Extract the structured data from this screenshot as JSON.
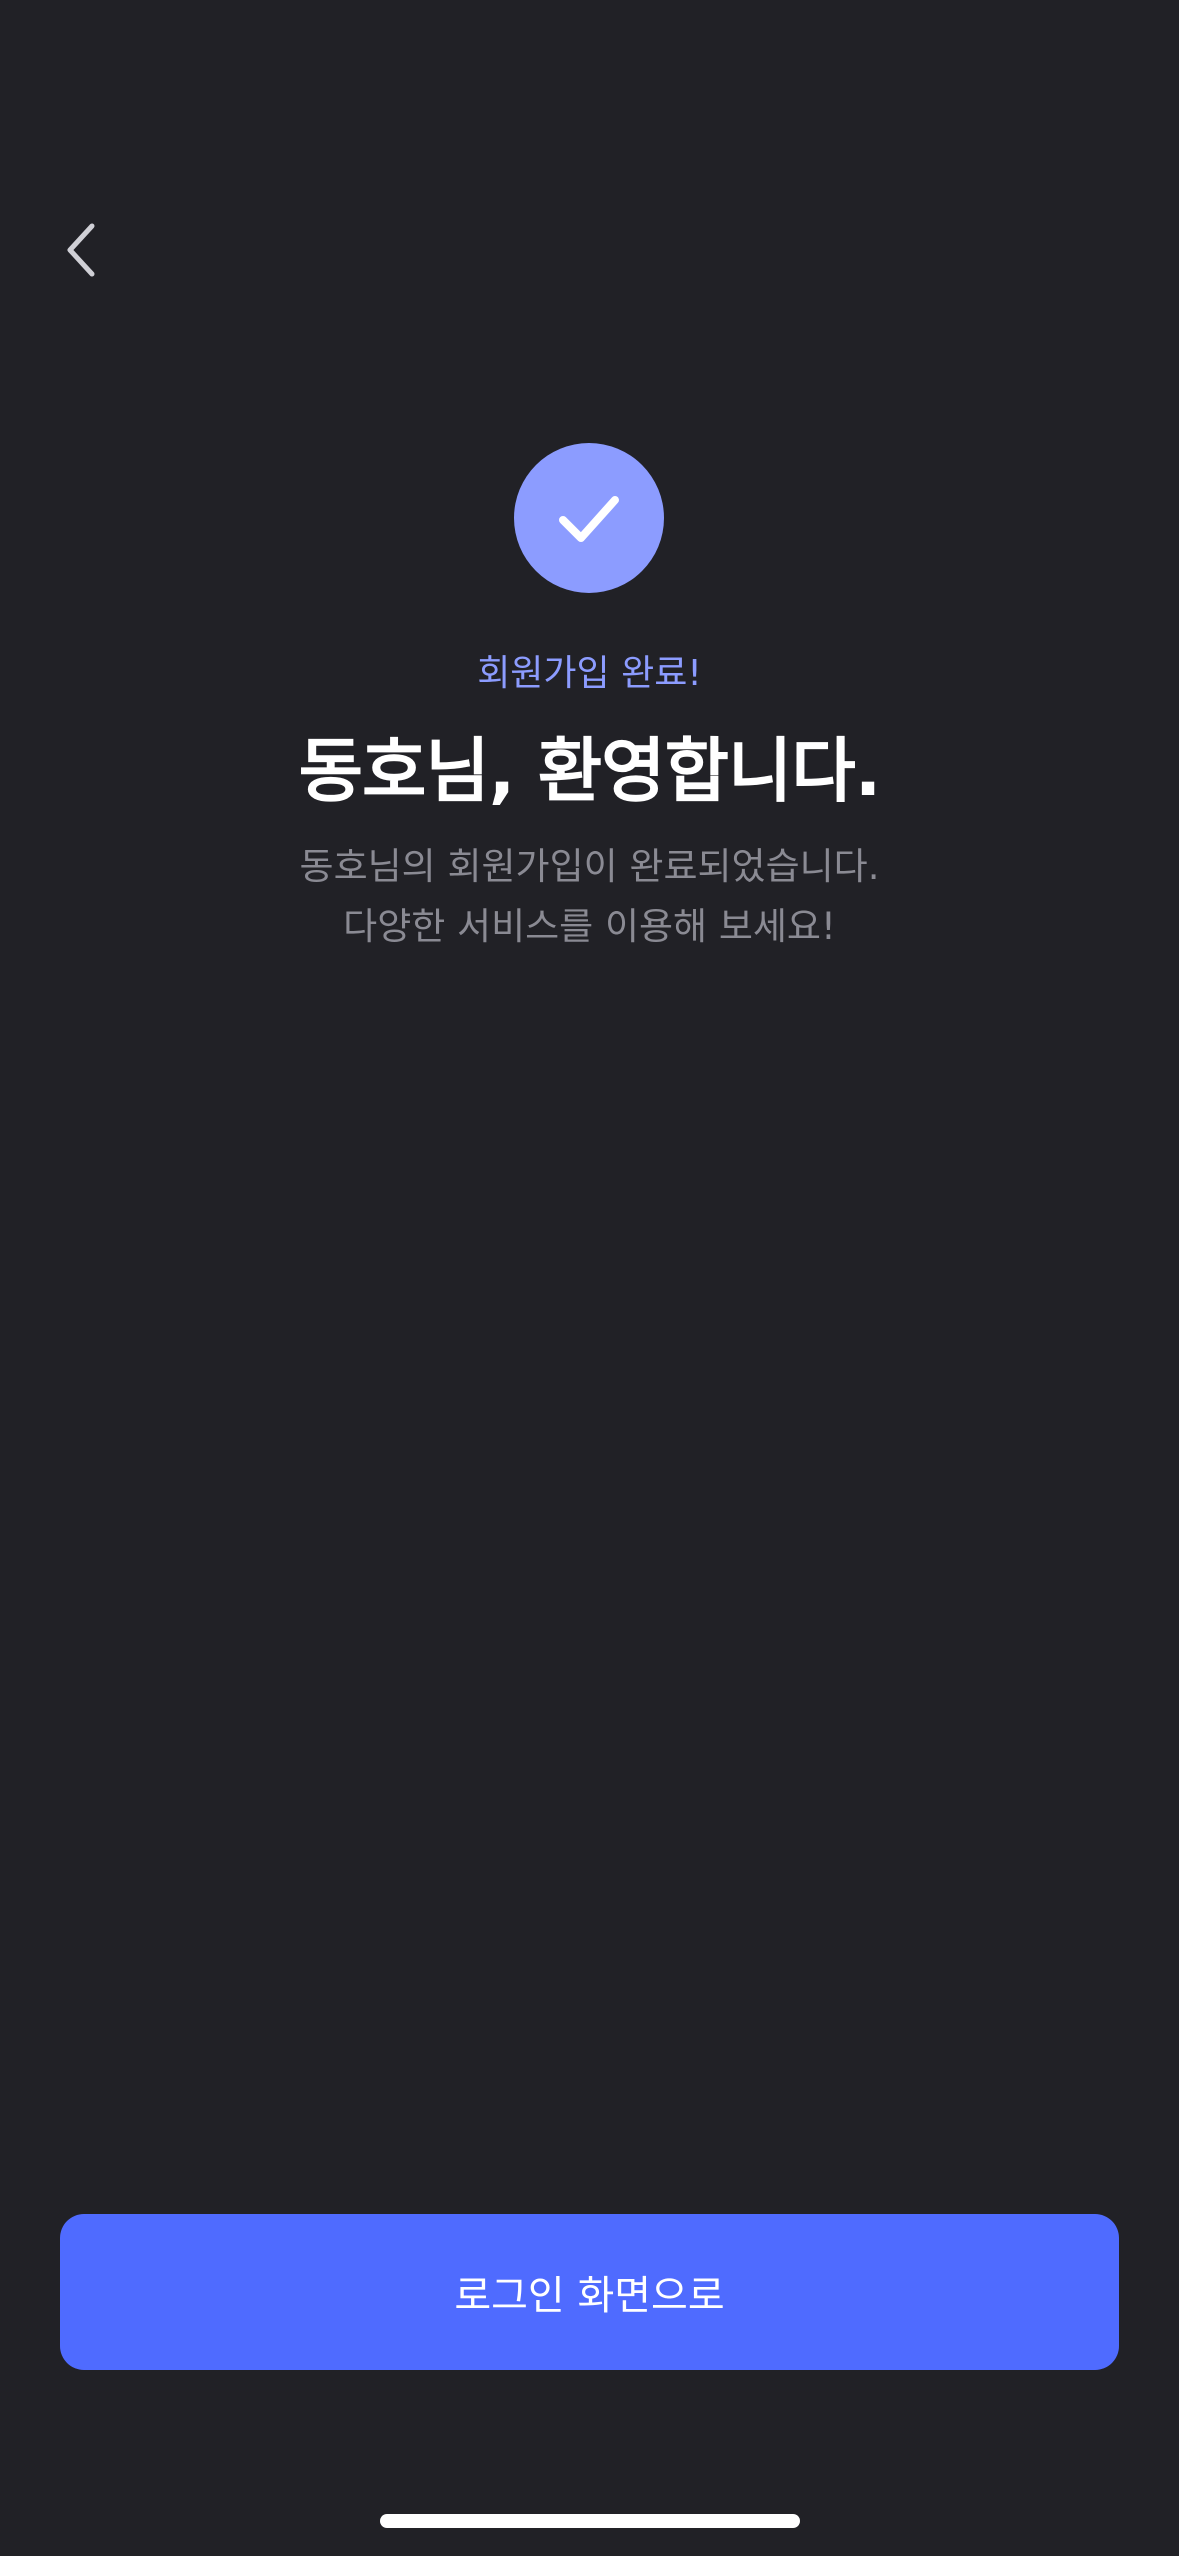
{
  "colors": {
    "background": "#212126",
    "accent": "#4F6BFF",
    "accent_light": "#8C9CFF",
    "eyebrow_text": "#8C9CFF",
    "secondary_text": "#8A8A93"
  },
  "nav": {
    "back_icon": "chevron-left-icon"
  },
  "hero": {
    "icon": "checkmark-icon",
    "eyebrow": "회원가입 완료!",
    "headline": "동호님, 환영합니다.",
    "description_line1": "동호님의 회원가입이 완료되었습니다.",
    "description_line2": "다양한 서비스를 이용해 보세요!"
  },
  "footer": {
    "primary_button_label": "로그인 화면으로"
  }
}
